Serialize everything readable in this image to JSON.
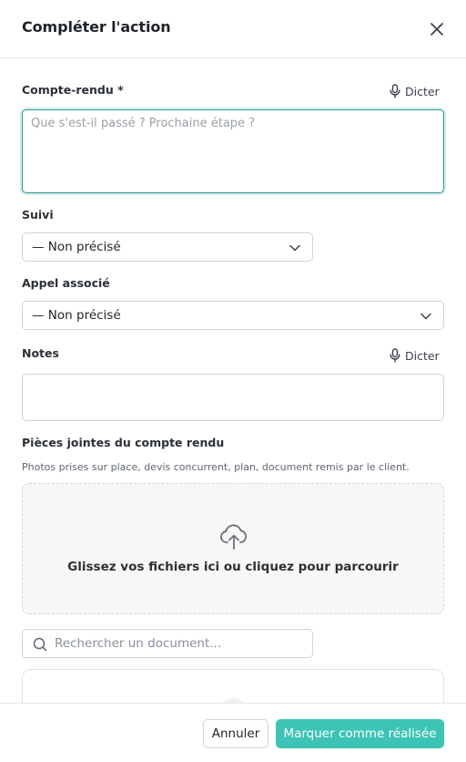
{
  "modal": {
    "title": "Compléter l'action"
  },
  "compte_rendu": {
    "label": "Compte-rendu *",
    "dictate_label": "Dicter",
    "placeholder": "Que s'est-il passé ? Prochaine étape ?"
  },
  "suivi": {
    "label": "Suivi",
    "selected": "— Non précisé"
  },
  "appel": {
    "label": "Appel associé",
    "selected": "— Non précisé"
  },
  "notes": {
    "label": "Notes",
    "dictate_label": "Dicter",
    "value": ""
  },
  "attachments": {
    "label": "Pièces jointes du compte rendu",
    "hint": "Photos prises sur place, devis concurrent, plan, document remis par le client.",
    "dropzone_text": "Glissez vos fichiers ici ou cliquez pour parcourir",
    "search_placeholder": "Rechercher un document..."
  },
  "footer": {
    "cancel_label": "Annuler",
    "submit_label": "Marquer comme réalisée"
  },
  "colors": {
    "accent": "#3cc4b4",
    "focus_border": "#2a9d8f"
  },
  "icons": [
    "close-icon",
    "microphone-icon",
    "chevron-down-icon",
    "cloud-upload-icon",
    "search-icon"
  ]
}
